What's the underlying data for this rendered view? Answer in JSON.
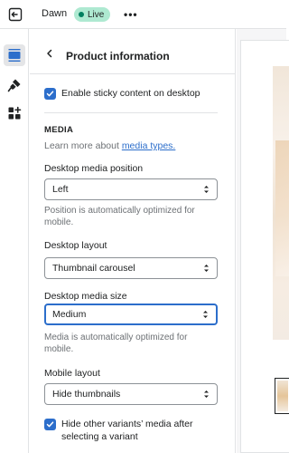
{
  "topbar": {
    "theme_name": "Dawn",
    "status_badge": "Live",
    "more_label": "•••"
  },
  "rail": {
    "items": [
      {
        "icon": "sections-icon",
        "active": true
      },
      {
        "icon": "theme-settings-icon",
        "active": false
      },
      {
        "icon": "app-embeds-icon",
        "active": false
      }
    ]
  },
  "panel": {
    "title": "Product information",
    "sticky_checkbox": {
      "label": "Enable sticky content on desktop",
      "checked": true
    },
    "media_section": {
      "heading": "MEDIA",
      "help_prefix": "Learn more about ",
      "help_link": "media types."
    },
    "desktop_media_position": {
      "label": "Desktop media position",
      "value": "Left",
      "help": "Position is automatically optimized for mobile."
    },
    "desktop_layout": {
      "label": "Desktop layout",
      "value": "Thumbnail carousel"
    },
    "desktop_media_size": {
      "label": "Desktop media size",
      "value": "Medium",
      "help": "Media is automatically optimized for mobile."
    },
    "mobile_layout": {
      "label": "Mobile layout",
      "value": "Hide thumbnails"
    },
    "hide_variants_checkbox": {
      "label": "Hide other variants’ media after selecting a variant",
      "checked": true
    }
  },
  "colors": {
    "accent": "#2c6ecb",
    "live_badge": "#aee9d1",
    "border": "#e1e3e5"
  }
}
